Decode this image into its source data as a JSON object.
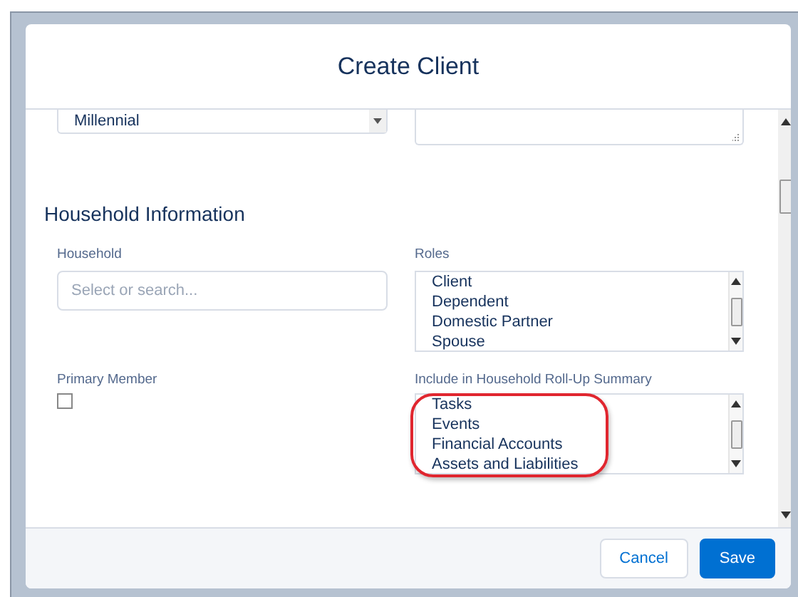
{
  "modal": {
    "title": "Create Client"
  },
  "top_fields": {
    "select_value": "Millennial"
  },
  "section": {
    "title": "Household Information"
  },
  "household": {
    "label": "Household",
    "placeholder": "Select or search..."
  },
  "roles": {
    "label": "Roles",
    "options": [
      "Client",
      "Dependent",
      "Domestic Partner",
      "Spouse"
    ]
  },
  "primary_member": {
    "label": "Primary Member",
    "checked": false
  },
  "rollup": {
    "label": "Include in Household Roll-Up Summary",
    "options": [
      "Tasks",
      "Events",
      "Financial Accounts",
      "Assets and Liabilities"
    ],
    "highlighted": true
  },
  "buttons": [
    {
      "label": "Cancel",
      "kind": "neutral"
    },
    {
      "label": "Save",
      "kind": "brand"
    }
  ]
}
